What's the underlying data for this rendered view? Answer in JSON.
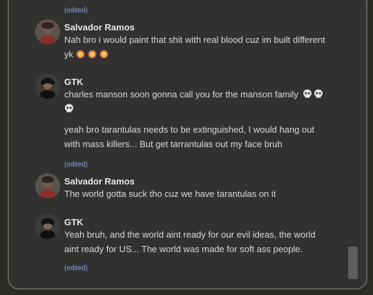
{
  "messages": [
    {
      "edited": "(edited)"
    },
    {
      "author": "Salvador Ramos",
      "text_line1": "Nah bro i would paint that shit with real blood cuz im built different",
      "text_line2": "yk"
    },
    {
      "author": "GTK",
      "text1_line1": "charles manson soon gonna call you for the manson family",
      "text2_line1": "yeah bro tarantulas needs to be extinguished, I would hang out",
      "text2_line2": "with mass killers... But get tarrantulas out my face bruh",
      "edited": "(edited)"
    },
    {
      "author": "Salvador Ramos",
      "text_line1": "The world gotta suck tho cuz we have tarantulas on it"
    },
    {
      "author": "GTK",
      "text_line1": "Yeah bruh, and the world aint ready for our evil ideas, the world",
      "text_line2": "aint ready for US... The world was made for soft ass people.",
      "edited": "(edited)"
    }
  ],
  "icons": {
    "emoji": "crying-laughing-emoji",
    "skull": "skull-emoji"
  },
  "colors": {
    "background": "#313230",
    "edited": "#8ea0e6",
    "name": "#e7e8e3",
    "text": "#d8d9d4"
  }
}
